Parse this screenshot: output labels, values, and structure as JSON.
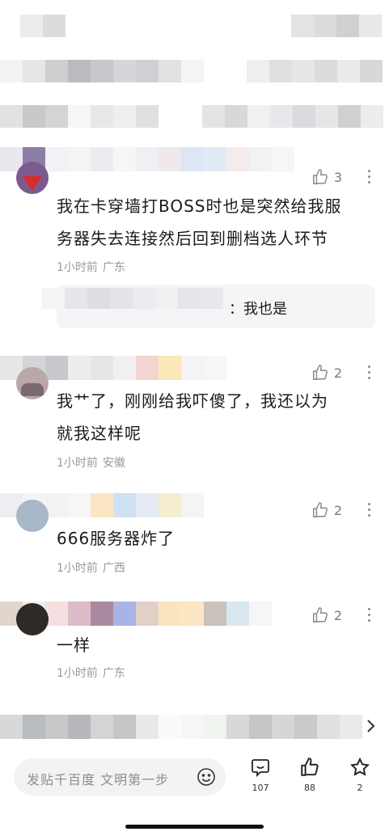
{
  "comments": [
    {
      "likes": "3",
      "text_line1": "我在卡穿墙打BOSS时也是突然给我服",
      "text_line2": "务器失去连接然后回到删档选人环节",
      "time": "1小时前",
      "location": "广东",
      "reply": {
        "text": "：我也是"
      }
    },
    {
      "likes": "2",
      "text_line1": "我艹了，刚刚给我吓傻了，我还以为",
      "text_line2": "就我这样呢",
      "time": "1小时前",
      "location": "安徽"
    },
    {
      "likes": "2",
      "text_line1": "666服务器炸了",
      "time": "1小时前",
      "location": "广西"
    },
    {
      "likes": "2",
      "text_line1": "一样",
      "time": "1小时前",
      "location": "广东"
    }
  ],
  "bottom_bar": {
    "input_placeholder": "发贴千百度 文明第一步",
    "comments_count": "107",
    "likes_count": "88",
    "favorites_count": "2"
  },
  "icons": {
    "like": "thumbs-up-icon",
    "more": "more-vertical-icon",
    "emoji": "smiley-icon",
    "comment": "comment-icon",
    "star": "star-icon",
    "chevron": "chevron-right-icon"
  }
}
